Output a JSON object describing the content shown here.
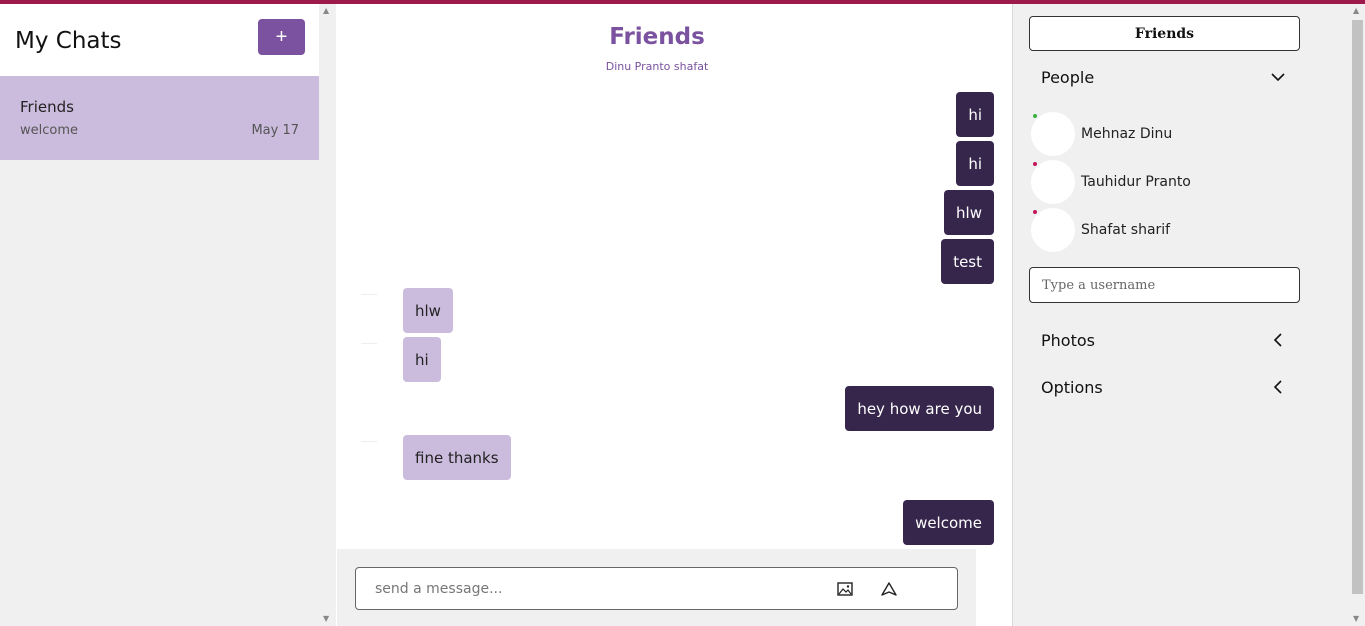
{
  "sidebar": {
    "title": "My Chats",
    "add_label": "+",
    "chats": [
      {
        "name": "Friends",
        "latest_message": "welcome",
        "date": "May 17"
      }
    ]
  },
  "chat": {
    "title": "Friends",
    "members": "Dinu Pranto shafat",
    "messages": [
      {
        "text": "hi",
        "direction": "out"
      },
      {
        "text": "hi",
        "direction": "out"
      },
      {
        "text": "hlw",
        "direction": "out"
      },
      {
        "text": "test",
        "direction": "out"
      },
      {
        "text": "hlw",
        "direction": "in"
      },
      {
        "text": "hi",
        "direction": "in"
      },
      {
        "text": "hey how are you",
        "direction": "out"
      },
      {
        "text": "fine thanks",
        "direction": "in"
      },
      {
        "text": "welcome",
        "direction": "out"
      }
    ],
    "composer": {
      "placeholder": "send a message...",
      "image_icon": "image-icon",
      "send_icon": "send-icon"
    }
  },
  "details": {
    "group_name": "Friends",
    "people_label": "People",
    "people": [
      {
        "name": "Mehnaz Dinu",
        "status": "online",
        "status_color": "#3cb043"
      },
      {
        "name": "Tauhidur Pranto",
        "status": "offline",
        "status_color": "#c2185b"
      },
      {
        "name": "Shafat sharif",
        "status": "offline",
        "status_color": "#c2185b"
      }
    ],
    "username_placeholder": "Type a username",
    "photos_label": "Photos",
    "options_label": "Options"
  },
  "colors": {
    "accent": "#7a529f",
    "outgoing_bubble": "#36264c",
    "incoming_bubble": "#cbbcdd",
    "top_bar": "#9e1a4a"
  }
}
